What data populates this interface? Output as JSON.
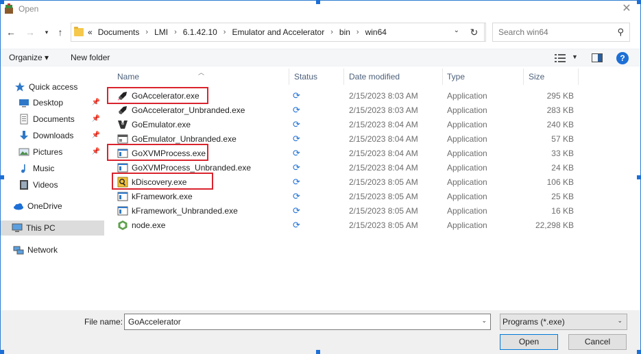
{
  "window": {
    "title": "Open"
  },
  "address": {
    "overflow": "«",
    "crumbs": [
      "Documents",
      "LMI",
      "6.1.42.10",
      "Emulator and Accelerator",
      "bin",
      "win64"
    ],
    "search_placeholder": "Search win64"
  },
  "toolbar": {
    "organize": "Organize ▾",
    "new_folder": "New folder"
  },
  "nav": {
    "items": [
      {
        "label": "Quick access",
        "icon": "star-icon"
      },
      {
        "label": "Desktop",
        "icon": "desktop-icon",
        "pinned": true
      },
      {
        "label": "Documents",
        "icon": "documents-icon",
        "pinned": true
      },
      {
        "label": "Downloads",
        "icon": "downloads-icon",
        "pinned": true
      },
      {
        "label": "Pictures",
        "icon": "pictures-icon",
        "pinned": true
      },
      {
        "label": "Music",
        "icon": "music-icon"
      },
      {
        "label": "Videos",
        "icon": "videos-icon"
      },
      {
        "label": "OneDrive",
        "icon": "cloud-icon"
      },
      {
        "label": "This PC",
        "icon": "computer-icon",
        "selected": true
      },
      {
        "label": "Network",
        "icon": "network-icon"
      }
    ]
  },
  "columns": {
    "name": "Name",
    "status": "Status",
    "date": "Date modified",
    "type": "Type",
    "size": "Size"
  },
  "files": [
    {
      "name": "GoAccelerator.exe",
      "status": "sync-icon",
      "date": "2/15/2023 8:03 AM",
      "type": "Application",
      "size": "295 KB",
      "icon": "rocket-icon",
      "highlighted": true
    },
    {
      "name": "GoAccelerator_Unbranded.exe",
      "status": "sync-icon",
      "date": "2/15/2023 8:03 AM",
      "type": "Application",
      "size": "283 KB",
      "icon": "rocket-icon"
    },
    {
      "name": "GoEmulator.exe",
      "status": "sync-icon",
      "date": "2/15/2023 8:04 AM",
      "type": "Application",
      "size": "240 KB",
      "icon": "emulator-icon"
    },
    {
      "name": "GoEmulator_Unbranded.exe",
      "status": "sync-icon",
      "date": "2/15/2023 8:04 AM",
      "type": "Application",
      "size": "57 KB",
      "icon": "app-window-icon"
    },
    {
      "name": "GoXVMProcess.exe",
      "status": "sync-icon",
      "date": "2/15/2023 8:04 AM",
      "type": "Application",
      "size": "33 KB",
      "icon": "app-window-icon",
      "highlighted": true
    },
    {
      "name": "GoXVMProcess_Unbranded.exe",
      "status": "sync-icon",
      "date": "2/15/2023 8:04 AM",
      "type": "Application",
      "size": "24 KB",
      "icon": "app-window-icon"
    },
    {
      "name": "kDiscovery.exe",
      "status": "sync-icon",
      "date": "2/15/2023 8:05 AM",
      "type": "Application",
      "size": "106 KB",
      "icon": "discovery-icon",
      "highlighted": true
    },
    {
      "name": "kFramework.exe",
      "status": "sync-icon",
      "date": "2/15/2023 8:05 AM",
      "type": "Application",
      "size": "25 KB",
      "icon": "app-window-icon"
    },
    {
      "name": "kFramework_Unbranded.exe",
      "status": "sync-icon",
      "date": "2/15/2023 8:05 AM",
      "type": "Application",
      "size": "16 KB",
      "icon": "app-window-icon"
    },
    {
      "name": "node.exe",
      "status": "sync-icon",
      "date": "2/15/2023 8:05 AM",
      "type": "Application",
      "size": "22,298 KB",
      "icon": "node-icon"
    }
  ],
  "footer": {
    "file_name_label": "File name:",
    "file_name_value": "GoAccelerator",
    "filter": "Programs (*.exe)",
    "open": "Open",
    "cancel": "Cancel"
  },
  "colors": {
    "accent": "#1d6fd6",
    "highlight": "#d9232d",
    "selection": "#dcdcdc"
  }
}
